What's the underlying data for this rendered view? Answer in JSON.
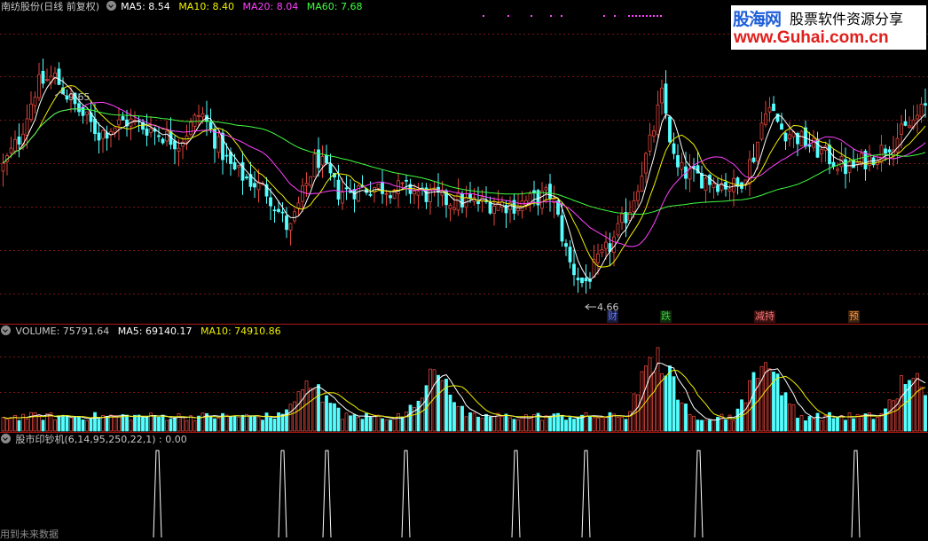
{
  "window": {
    "title": "南纺股份(日线 前复权)"
  },
  "price_header": {
    "items": [
      {
        "label": "MA5: 8.54",
        "color": "#ffffff"
      },
      {
        "label": "MA10: 8.40",
        "color": "#f0f000"
      },
      {
        "label": "MA20: 8.04",
        "color": "#ff40ff"
      },
      {
        "label": "MA60: 7.68",
        "color": "#40ff40"
      }
    ]
  },
  "volume_header": {
    "title": "VOLUME: 75791.64",
    "items": [
      {
        "label": "MA5: 69140.17",
        "color": "#ffffff"
      },
      {
        "label": "MA10: 74910.86",
        "color": "#f0f000"
      }
    ]
  },
  "indicator_header": {
    "title": "股市印钞机(6,14,95,250,22,1) : 0.00"
  },
  "annotations": {
    "high": "9.65",
    "low": "4.66"
  },
  "event_tags": [
    {
      "text": "财",
      "color": "#5a7cff"
    },
    {
      "text": "跌",
      "color": "#3ccf3c"
    },
    {
      "text": "减持",
      "color": "#ff7a7a"
    },
    {
      "text": "预",
      "color": "#ff9a3a"
    }
  ],
  "logo": {
    "brand": "股海网",
    "slogan": "股票软件资源分享",
    "url": "www.Guhai.com.cn"
  },
  "footer": {
    "note": "用到未来数据"
  },
  "colors": {
    "up": "#e0453c",
    "down": "#54ffff",
    "grid": "#7a1414",
    "ma5": "#ffffff",
    "ma10": "#f0f000",
    "ma20": "#ff40ff",
    "ma60": "#40ff40"
  },
  "chart_data": [
    {
      "type": "candlestick",
      "title": "南纺股份(日线 前复权)",
      "series": [
        "MA5",
        "MA10",
        "MA20",
        "MA60"
      ],
      "ma_values": [
        8.54,
        8.4,
        8.04,
        7.68
      ],
      "high_marker": 9.65,
      "low_marker": 4.66
    },
    {
      "type": "bar",
      "title": "VOLUME",
      "series": [
        "VOLUME",
        "MA5",
        "MA10"
      ],
      "values": [
        75791.64,
        69140.17,
        74910.86
      ]
    },
    {
      "type": "signal",
      "title": "股市印钞机(6,14,95,250,22,1)",
      "params": [
        6,
        14,
        95,
        250,
        22,
        1
      ],
      "value": 0.0,
      "signal_count": 8
    }
  ]
}
